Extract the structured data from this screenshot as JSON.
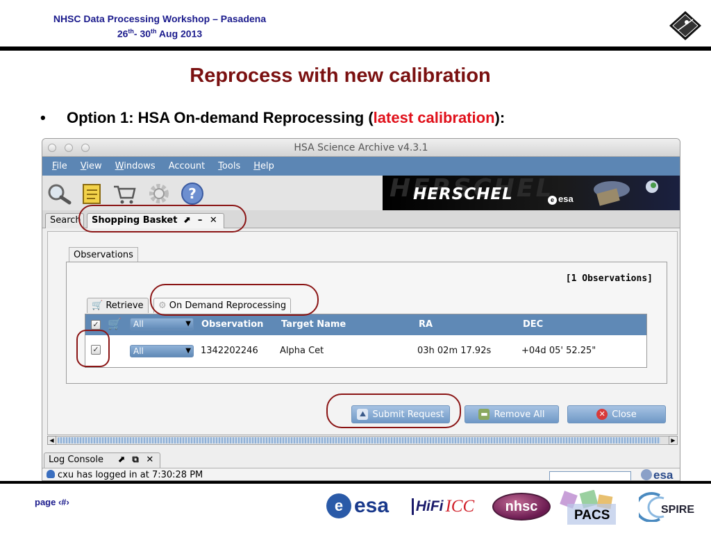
{
  "slide": {
    "workshop_line1": "NHSC Data Processing Workshop – Pasadena",
    "date_d1": "26",
    "date_sup1": "th",
    "date_sep": "- 30",
    "date_sup2": "th",
    "date_rest": " Aug 2013",
    "title": "Reprocess with new calibration",
    "bullet_prefix": "Option 1: HSA On-demand Reprocessing (",
    "bullet_highlight": "latest calibration",
    "bullet_suffix": "):",
    "page_label": "page ‹#›",
    "highlight_color": "#e0101a",
    "title_color": "#7a1010"
  },
  "app": {
    "window_title": "HSA Science Archive v4.3.1",
    "menu": [
      {
        "pre": "",
        "ul": "F",
        "post": "ile"
      },
      {
        "pre": "",
        "ul": "V",
        "post": "iew"
      },
      {
        "pre": "",
        "ul": "W",
        "post": "indows"
      },
      {
        "pre": "Account",
        "ul": "",
        "post": ""
      },
      {
        "pre": "",
        "ul": "T",
        "post": "ools"
      },
      {
        "pre": "",
        "ul": "H",
        "post": "elp"
      }
    ],
    "toolbar_icons": [
      "search-icon",
      "notepad-icon",
      "cart-icon",
      "gear-icon",
      "help-icon"
    ],
    "banner_ghost": "HERSCHEL",
    "banner_title": "HERSCHEL",
    "banner_brand": "esa",
    "tabs": {
      "search": "Search",
      "shopping_basket": "Shopping Basket",
      "controls": "⬈ – ✕"
    },
    "observations_tab": "Observations",
    "obs_count": "[1 Observations]",
    "subtabs": {
      "retrieve": "Retrieve",
      "on_demand": "On Demand Reprocessing"
    },
    "table": {
      "header_select": "All",
      "columns": [
        "Observation",
        "Target  Name",
        "RA",
        "DEC"
      ],
      "rows": [
        {
          "checked": "✓",
          "select": "All",
          "observation": "1342202246",
          "target": "Alpha Cet",
          "ra": "03h 02m 17.92s",
          "dec": "+04d 05' 52.25\""
        }
      ]
    },
    "buttons": {
      "submit": "Submit Request",
      "remove_all": "Remove All",
      "close": "Close"
    },
    "log_console": "Log Console",
    "log_controls": "⬈ ⧉ ✕",
    "status_text": "cxu has logged in at 7:30:28 PM",
    "status_brand": "esa",
    "accent_color": "#5c86b4"
  },
  "footer": {
    "logo_esa": "esa",
    "logo_hifi": "HiFi",
    "logo_icc": "ICC",
    "logo_nhsc": "nhsc",
    "logo_pacs": "PACS",
    "logo_spire": "SPIRE"
  }
}
